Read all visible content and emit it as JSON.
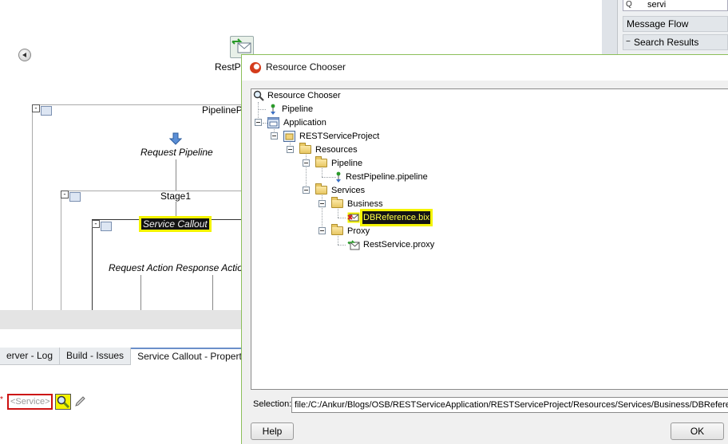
{
  "canvas": {
    "proxy_label": "RestP",
    "pipeline_label": "PipelineP",
    "request_pipeline_label": "Request Pipeline",
    "stage_label": "Stage1",
    "service_callout_label": "Service Callout",
    "actions_label": "Request Action Response Actio"
  },
  "bottom_tabs": [
    {
      "label": "erver - Log"
    },
    {
      "label": "Build - Issues"
    },
    {
      "label": "Service Callout - Properties"
    }
  ],
  "properties": {
    "required_mark": "*",
    "service_field_value": "<Service>"
  },
  "right_panel": {
    "search_value": "servi",
    "search_icon": "Q",
    "items": [
      "Message Flow",
      "Search Results"
    ],
    "collapse_marker": "−"
  },
  "dialog": {
    "title": "Resource Chooser",
    "tree": {
      "root": "Resource Chooser",
      "pipeline": "Pipeline",
      "application": "Application",
      "project": "RESTServiceProject",
      "resources": "Resources",
      "pipeline_folder": "Pipeline",
      "pipeline_file": "RestPipeline.pipeline",
      "services": "Services",
      "business": "Business",
      "business_file": "DBReference.bix",
      "proxy": "Proxy",
      "proxy_file": "RestService.proxy"
    },
    "selection_label": "Selection:",
    "selection_value": "file:/C:/Ankur/Blogs/OSB/RESTServiceApplication/RESTServiceProject/Resources/Services/Business/DBReference.bix",
    "help_button": "Help",
    "ok_button": "OK"
  },
  "colors": {
    "highlight": "#f4f400",
    "dialog_border": "#8cbf5a",
    "required_red": "#cc1111"
  }
}
